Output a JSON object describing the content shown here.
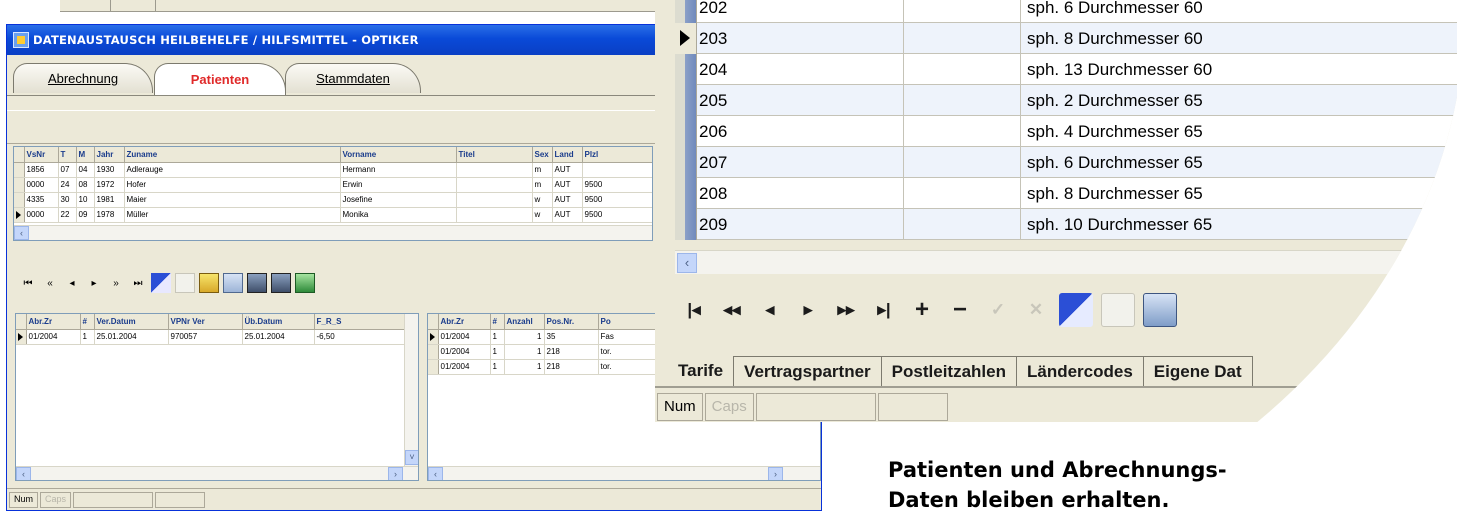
{
  "window": {
    "title": "DATENAUSTAUSCH HEILBEHELFE / HILFSMITTEL  -  OPTIKER"
  },
  "tabs": [
    {
      "label": "Abrechnung"
    },
    {
      "label": "Patienten"
    },
    {
      "label": "Stammdaten"
    }
  ],
  "patients_grid": {
    "columns": [
      "VsNr",
      "T",
      "M",
      "Jahr",
      "Zuname",
      "Vorname",
      "Titel",
      "Sex",
      "Land",
      "Plzl"
    ],
    "rows": [
      [
        "1856",
        "07",
        "04",
        "1930",
        "Adlerauge",
        "Hermann",
        "",
        "m",
        "AUT",
        ""
      ],
      [
        "0000",
        "24",
        "08",
        "1972",
        "Hofer",
        "Erwin",
        "",
        "m",
        "AUT",
        "9500"
      ],
      [
        "4335",
        "30",
        "10",
        "1981",
        "Maier",
        "Josefine",
        "",
        "w",
        "AUT",
        "9500"
      ],
      [
        "0000",
        "22",
        "09",
        "1978",
        "Müller",
        "Monika",
        "",
        "w",
        "AUT",
        "9500"
      ]
    ]
  },
  "billing_grid": {
    "columns": [
      "Abr.Zr",
      "#",
      "Ver.Datum",
      "VPNr Ver",
      "Üb.Datum",
      "F_R_S"
    ],
    "rows": [
      [
        "01/2004",
        "1",
        "25.01.2004",
        "970057",
        "25.01.2004",
        "-6,50"
      ]
    ]
  },
  "positions_grid": {
    "columns": [
      "Abr.Zr",
      "#",
      "Anzahl",
      "Pos.Nr.",
      "Po"
    ],
    "rows": [
      [
        "01/2004",
        "1",
        "1",
        "35",
        "Fas"
      ],
      [
        "01/2004",
        "1",
        "1",
        "218",
        "tor."
      ],
      [
        "01/2004",
        "1",
        "1",
        "218",
        "tor."
      ]
    ]
  },
  "status": {
    "num": "Num",
    "caps": "Caps"
  },
  "zoom_grid": {
    "rows": [
      {
        "nr": "202",
        "desc": "sph. 6 Durchmesser 60"
      },
      {
        "nr": "203",
        "desc": "sph. 8 Durchmesser 60"
      },
      {
        "nr": "204",
        "desc": "sph. 13 Durchmesser 60"
      },
      {
        "nr": "205",
        "desc": "sph. 2 Durchmesser 65"
      },
      {
        "nr": "206",
        "desc": "sph. 4 Durchmesser 65"
      },
      {
        "nr": "207",
        "desc": "sph. 6 Durchmesser 65"
      },
      {
        "nr": "208",
        "desc": "sph. 8 Durchmesser 65"
      },
      {
        "nr": "209",
        "desc": "sph. 10 Durchmesser 65"
      }
    ]
  },
  "zoom_tabs": [
    {
      "label": "Tarife"
    },
    {
      "label": "Vertragspartner"
    },
    {
      "label": "Postleitzahlen"
    },
    {
      "label": "Ländercodes"
    },
    {
      "label": "Eigene Dat"
    }
  ],
  "caption": {
    "line1": "Patienten und Abrechnungs-",
    "line2": "Daten bleiben erhalten."
  },
  "colors": {
    "titlebar": "#0a4ad8",
    "active_tab_text": "#e02a2a",
    "window_bg": "#ece9d8"
  }
}
